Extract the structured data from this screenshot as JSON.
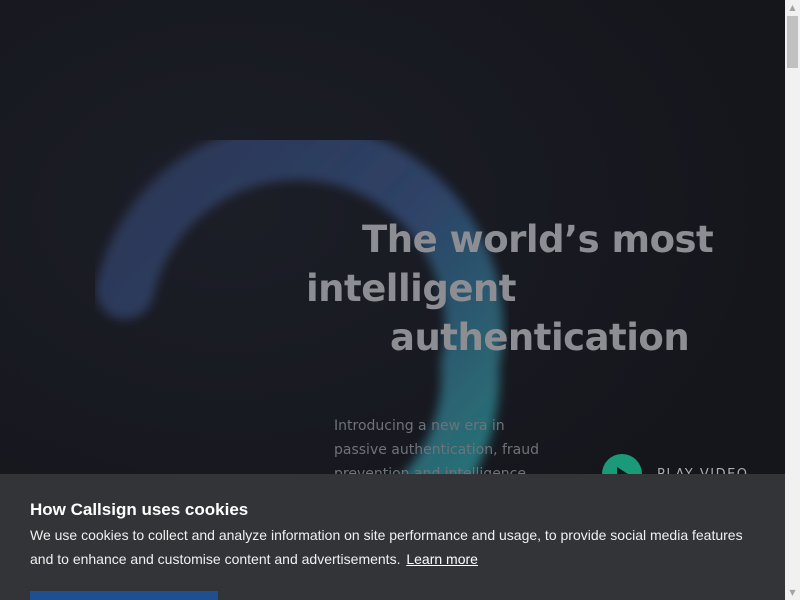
{
  "hero": {
    "title_line1": "The world’s most",
    "title_line2": "intelligent",
    "title_line3": "authentication",
    "subtitle": "Introducing a new era in passive authentication, fraud prevention and intelligence",
    "play_label": "PLAY VIDEO"
  },
  "cookie_banner": {
    "title": "How Callsign uses cookies",
    "text": "We use cookies to collect and analyze information on site performance and usage, to provide social media features and to enhance and customise content and advertisements.",
    "learn_more": "Learn more"
  },
  "colors": {
    "background": "#16171d",
    "accent_green": "#1a9a78",
    "banner_bg": "#333438",
    "button_blue": "#1d4f91"
  },
  "icons": {
    "play": "play-icon",
    "scroll_up": "scroll-up-arrow-icon",
    "scroll_down": "scroll-down-arrow-icon"
  }
}
